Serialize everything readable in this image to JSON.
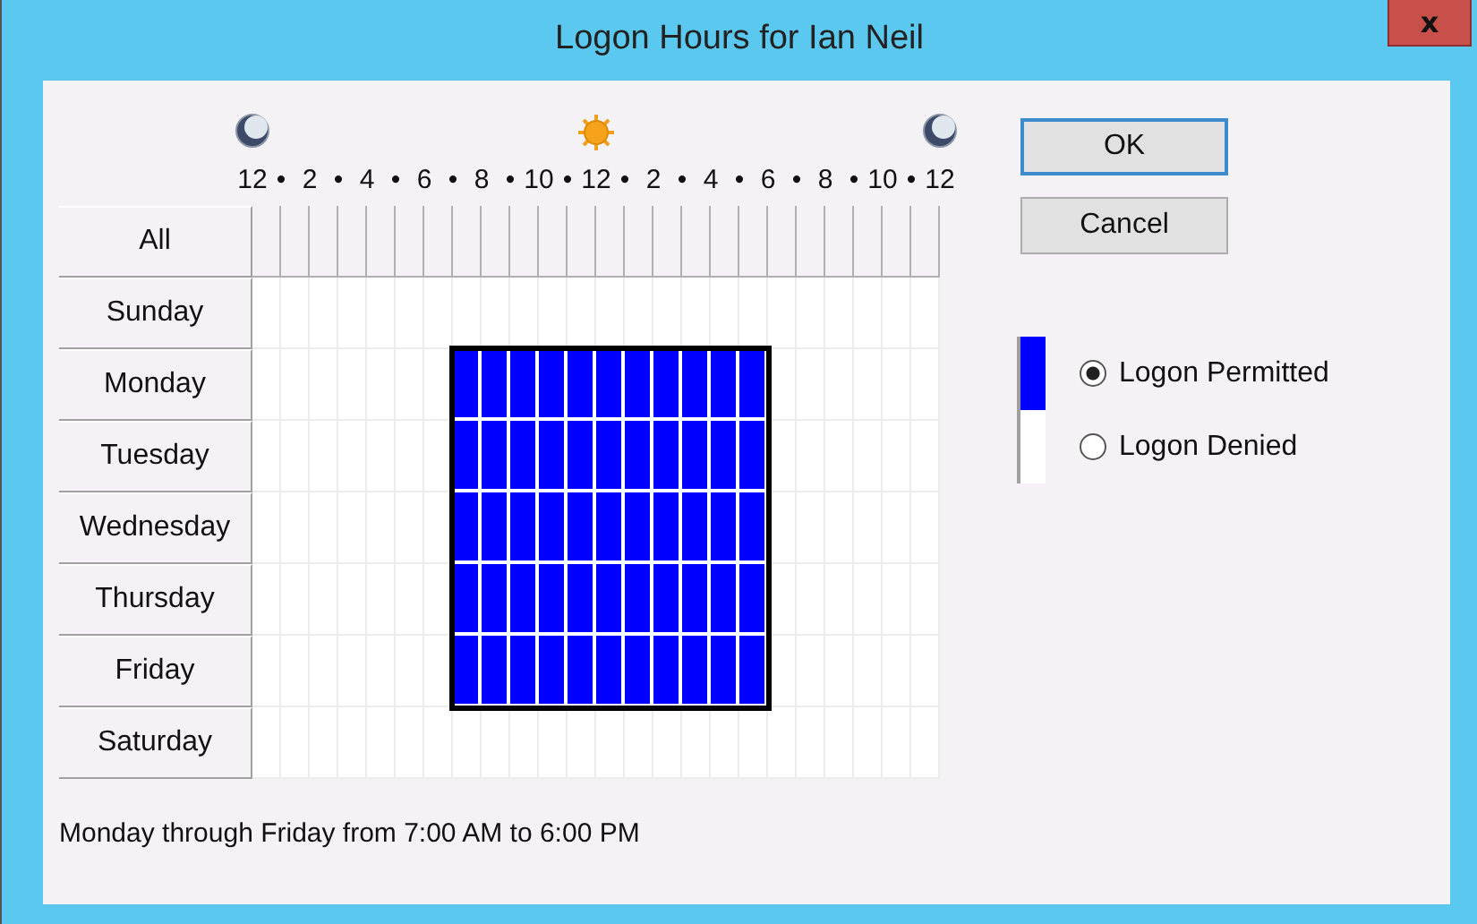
{
  "window": {
    "title": "Logon Hours for Ian Neil",
    "close": "x"
  },
  "scale": [
    {
      "label": "12",
      "kind": "moon"
    },
    {
      "label": "•"
    },
    {
      "label": "2"
    },
    {
      "label": "•"
    },
    {
      "label": "4"
    },
    {
      "label": "•"
    },
    {
      "label": "6"
    },
    {
      "label": "•"
    },
    {
      "label": "8"
    },
    {
      "label": "•"
    },
    {
      "label": "10"
    },
    {
      "label": "•"
    },
    {
      "label": "12",
      "kind": "sun"
    },
    {
      "label": "•"
    },
    {
      "label": "2"
    },
    {
      "label": "•"
    },
    {
      "label": "4"
    },
    {
      "label": "•"
    },
    {
      "label": "6"
    },
    {
      "label": "•"
    },
    {
      "label": "8"
    },
    {
      "label": "•"
    },
    {
      "label": "10"
    },
    {
      "label": "•"
    },
    {
      "label": "12",
      "kind": "moon"
    }
  ],
  "grid": {
    "all_label": "All",
    "days": [
      {
        "label": "Sunday",
        "hours": [
          false,
          false,
          false,
          false,
          false,
          false,
          false,
          false,
          false,
          false,
          false,
          false,
          false,
          false,
          false,
          false,
          false,
          false,
          false,
          false,
          false,
          false,
          false,
          false
        ]
      },
      {
        "label": "Monday",
        "hours": [
          false,
          false,
          false,
          false,
          false,
          false,
          false,
          true,
          true,
          true,
          true,
          true,
          true,
          true,
          true,
          true,
          true,
          true,
          false,
          false,
          false,
          false,
          false,
          false
        ]
      },
      {
        "label": "Tuesday",
        "hours": [
          false,
          false,
          false,
          false,
          false,
          false,
          false,
          true,
          true,
          true,
          true,
          true,
          true,
          true,
          true,
          true,
          true,
          true,
          false,
          false,
          false,
          false,
          false,
          false
        ]
      },
      {
        "label": "Wednesday",
        "hours": [
          false,
          false,
          false,
          false,
          false,
          false,
          false,
          true,
          true,
          true,
          true,
          true,
          true,
          true,
          true,
          true,
          true,
          true,
          false,
          false,
          false,
          false,
          false,
          false
        ]
      },
      {
        "label": "Thursday",
        "hours": [
          false,
          false,
          false,
          false,
          false,
          false,
          false,
          true,
          true,
          true,
          true,
          true,
          true,
          true,
          true,
          true,
          true,
          true,
          false,
          false,
          false,
          false,
          false,
          false
        ]
      },
      {
        "label": "Friday",
        "hours": [
          false,
          false,
          false,
          false,
          false,
          false,
          false,
          true,
          true,
          true,
          true,
          true,
          true,
          true,
          true,
          true,
          true,
          true,
          false,
          false,
          false,
          false,
          false,
          false
        ]
      },
      {
        "label": "Saturday",
        "hours": [
          false,
          false,
          false,
          false,
          false,
          false,
          false,
          false,
          false,
          false,
          false,
          false,
          false,
          false,
          false,
          false,
          false,
          false,
          false,
          false,
          false,
          false,
          false,
          false
        ]
      }
    ]
  },
  "buttons": [
    {
      "label": "OK",
      "default": true
    },
    {
      "label": "Cancel",
      "default": false
    }
  ],
  "legend": [
    {
      "label": "Logon Permitted",
      "selected": true,
      "color": "#0000ff"
    },
    {
      "label": "Logon Denied",
      "selected": false,
      "color": "#ffffff"
    }
  ],
  "status": "Monday through Friday from 7:00 AM to 6:00 PM"
}
